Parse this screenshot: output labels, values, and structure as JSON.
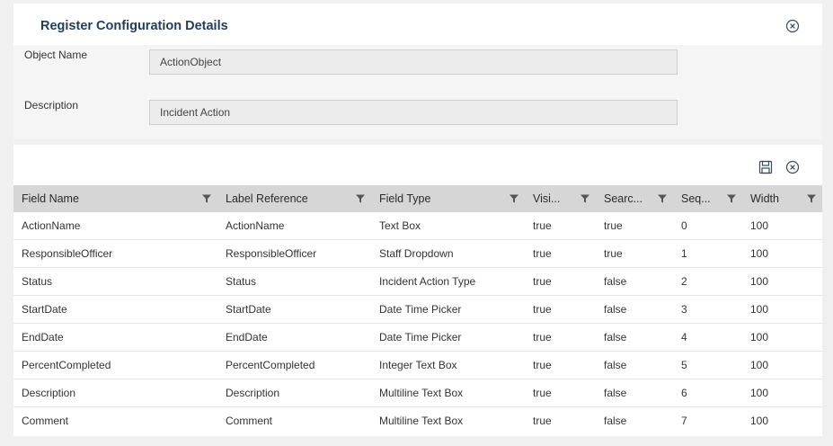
{
  "dialog": {
    "title": "Register Configuration Details"
  },
  "form": {
    "object_name_label": "Object Name",
    "object_name_value": "ActionObject",
    "description_label": "Description",
    "description_value": "Incident Action"
  },
  "toolbar": {
    "save_icon": "save-icon",
    "cancel_icon": "close-circle-icon"
  },
  "grid": {
    "columns": [
      {
        "label": "Field Name"
      },
      {
        "label": "Label Reference"
      },
      {
        "label": "Field Type"
      },
      {
        "label": "Visi..."
      },
      {
        "label": "Searc..."
      },
      {
        "label": "Seq..."
      },
      {
        "label": "Width"
      }
    ],
    "rows": [
      [
        "ActionName",
        "ActionName",
        "Text Box",
        "true",
        "true",
        "0",
        "100"
      ],
      [
        "ResponsibleOfficer",
        "ResponsibleOfficer",
        "Staff Dropdown",
        "true",
        "true",
        "1",
        "100"
      ],
      [
        "Status",
        "Status",
        "Incident Action Type",
        "true",
        "false",
        "2",
        "100"
      ],
      [
        "StartDate",
        "StartDate",
        "Date Time Picker",
        "true",
        "false",
        "3",
        "100"
      ],
      [
        "EndDate",
        "EndDate",
        "Date Time Picker",
        "true",
        "false",
        "4",
        "100"
      ],
      [
        "PercentCompleted",
        "PercentCompleted",
        "Integer Text Box",
        "true",
        "false",
        "5",
        "100"
      ],
      [
        "Description",
        "Description",
        "Multiline Text Box",
        "true",
        "false",
        "6",
        "100"
      ],
      [
        "Comment",
        "Comment",
        "Multiline Text Box",
        "true",
        "false",
        "7",
        "100"
      ]
    ]
  }
}
